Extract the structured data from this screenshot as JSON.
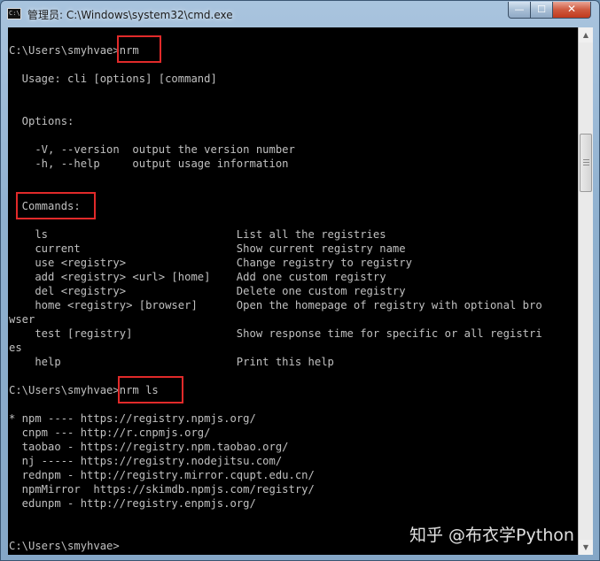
{
  "window": {
    "title": "管理员: C:\\Windows\\system32\\cmd.exe",
    "app_icon_label": "C:\\",
    "minimize_glyph": "—",
    "maximize_glyph": "☐",
    "close_glyph": "✕",
    "icons": {
      "app": "console-icon",
      "minimize": "minimize-icon",
      "maximize": "maximize-icon",
      "close": "close-icon"
    },
    "colors": {
      "console_bg": "#000000",
      "console_text": "#C0C0C0",
      "highlight": "#E12A2A",
      "close_button": "#C7442A"
    }
  },
  "console": {
    "lines": [
      "C:\\Users\\smyhvae>nrm",
      "",
      "  Usage: cli [options] [command]",
      "",
      "",
      "  Options:",
      "",
      "    -V, --version  output the version number",
      "    -h, --help     output usage information",
      "",
      "",
      "  Commands:",
      "",
      "    ls                             List all the registries",
      "    current                        Show current registry name",
      "    use <registry>                 Change registry to registry",
      "    add <registry> <url> [home]    Add one custom registry",
      "    del <registry>                 Delete one custom registry",
      "    home <registry> [browser]      Open the homepage of registry with optional bro",
      "wser",
      "    test [registry]                Show response time for specific or all registri",
      "es",
      "    help                           Print this help",
      "",
      "C:\\Users\\smyhvae>nrm ls",
      "",
      "* npm ---- https://registry.npmjs.org/",
      "  cnpm --- http://r.cnpmjs.org/",
      "  taobao - https://registry.npm.taobao.org/",
      "  nj ----- https://registry.nodejitsu.com/",
      "  rednpm - http://registry.mirror.cqupt.edu.cn/",
      "  npmMirror  https://skimdb.npmjs.com/registry/",
      "  edunpm - http://registry.enpmjs.org/",
      "",
      "",
      "C:\\Users\\smyhvae>"
    ]
  },
  "scrollbar": {
    "up_glyph": "▲",
    "down_glyph": "▼"
  },
  "watermark": {
    "text": "知乎 @布衣学Python"
  }
}
